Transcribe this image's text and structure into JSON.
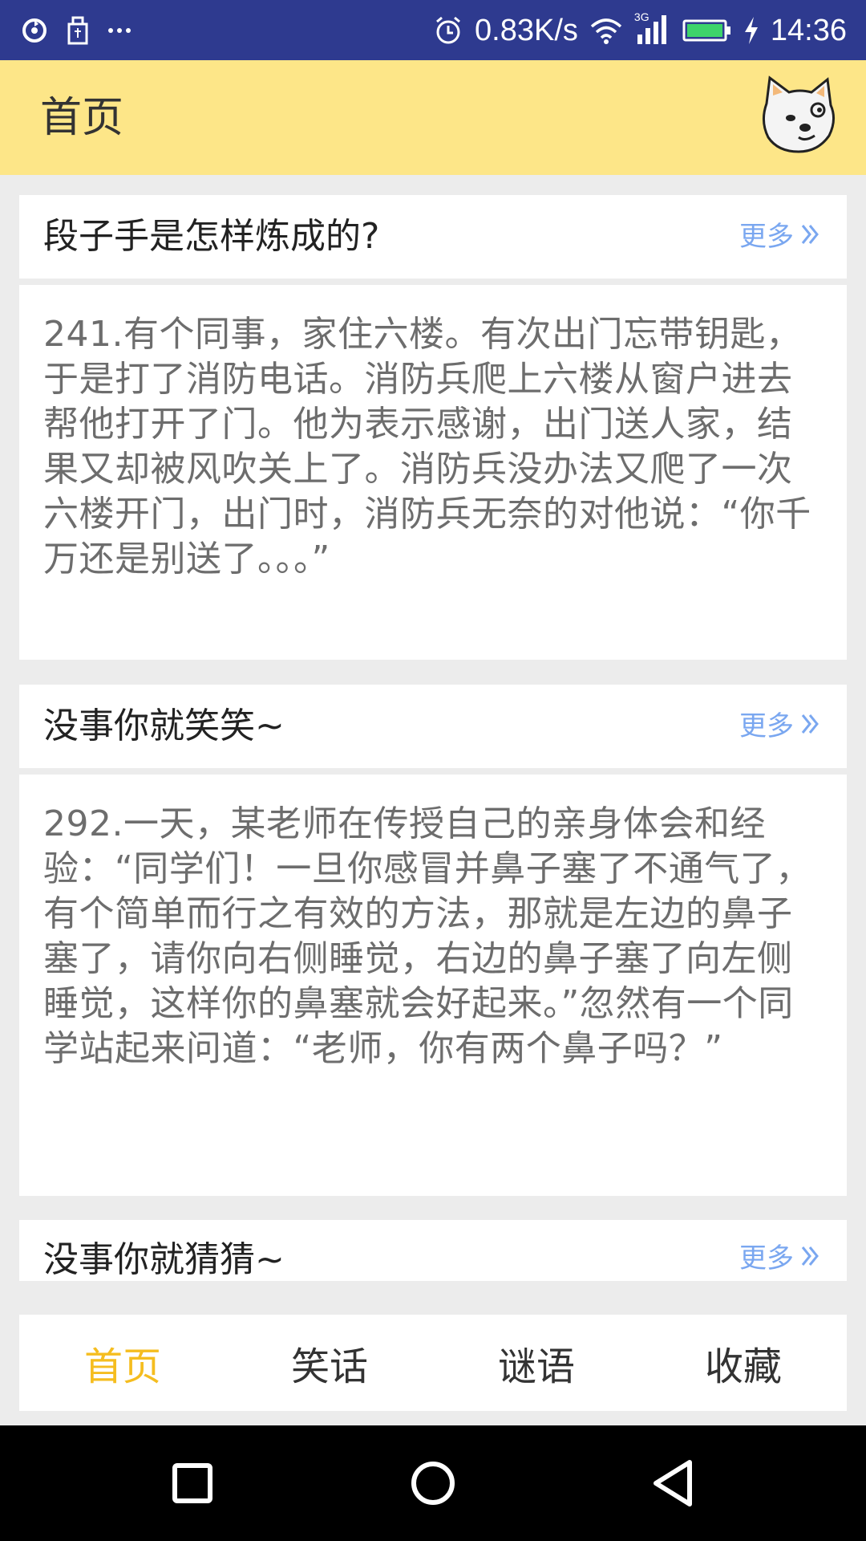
{
  "status_bar": {
    "net_speed": "0.83K/s",
    "network_type": "3G",
    "time": "14:36",
    "icons": [
      "sync-icon",
      "usb-icon",
      "more-icon",
      "alarm-icon",
      "wifi-icon",
      "signal-icon",
      "battery-icon",
      "charging-icon"
    ]
  },
  "app_bar": {
    "title": "首页",
    "avatar_icon": "cat-face-icon"
  },
  "sections": [
    {
      "title": "段子手是怎样炼成的?",
      "more_label": "更多",
      "content": "241.有个同事，家住六楼。有次出门忘带钥匙，于是打了消防电话。消防兵爬上六楼从窗户进去帮他打开了门。他为表示感谢，出门送人家，结果又却被风吹关上了。消防兵没办法又爬了一次六楼开门，出门时，消防兵无奈的对他说：“你千万还是别送了。。。”"
    },
    {
      "title": "没事你就笑笑~",
      "more_label": "更多",
      "content": "292.一天，某老师在传授自己的亲身体会和经验：“同学们！一旦你感冒并鼻子塞了不通气了，有个简单而行之有效的方法，那就是左边的鼻子塞了，请你向右侧睡觉，右边的鼻子塞了向左侧睡觉，这样你的鼻塞就会好起来。”忽然有一个同学站起来问道：“老师，你有两个鼻子吗？”"
    },
    {
      "title": "没事你就猜猜~",
      "more_label": "更多"
    }
  ],
  "tabs": [
    {
      "label": "首页",
      "active": true
    },
    {
      "label": "笑话",
      "active": false
    },
    {
      "label": "谜语",
      "active": false
    },
    {
      "label": "收藏",
      "active": false
    }
  ],
  "colors": {
    "status_bar": "#2e3a8f",
    "app_bar": "#fde688",
    "accent": "#f5bd1f",
    "more_link": "#7aa7f0"
  }
}
